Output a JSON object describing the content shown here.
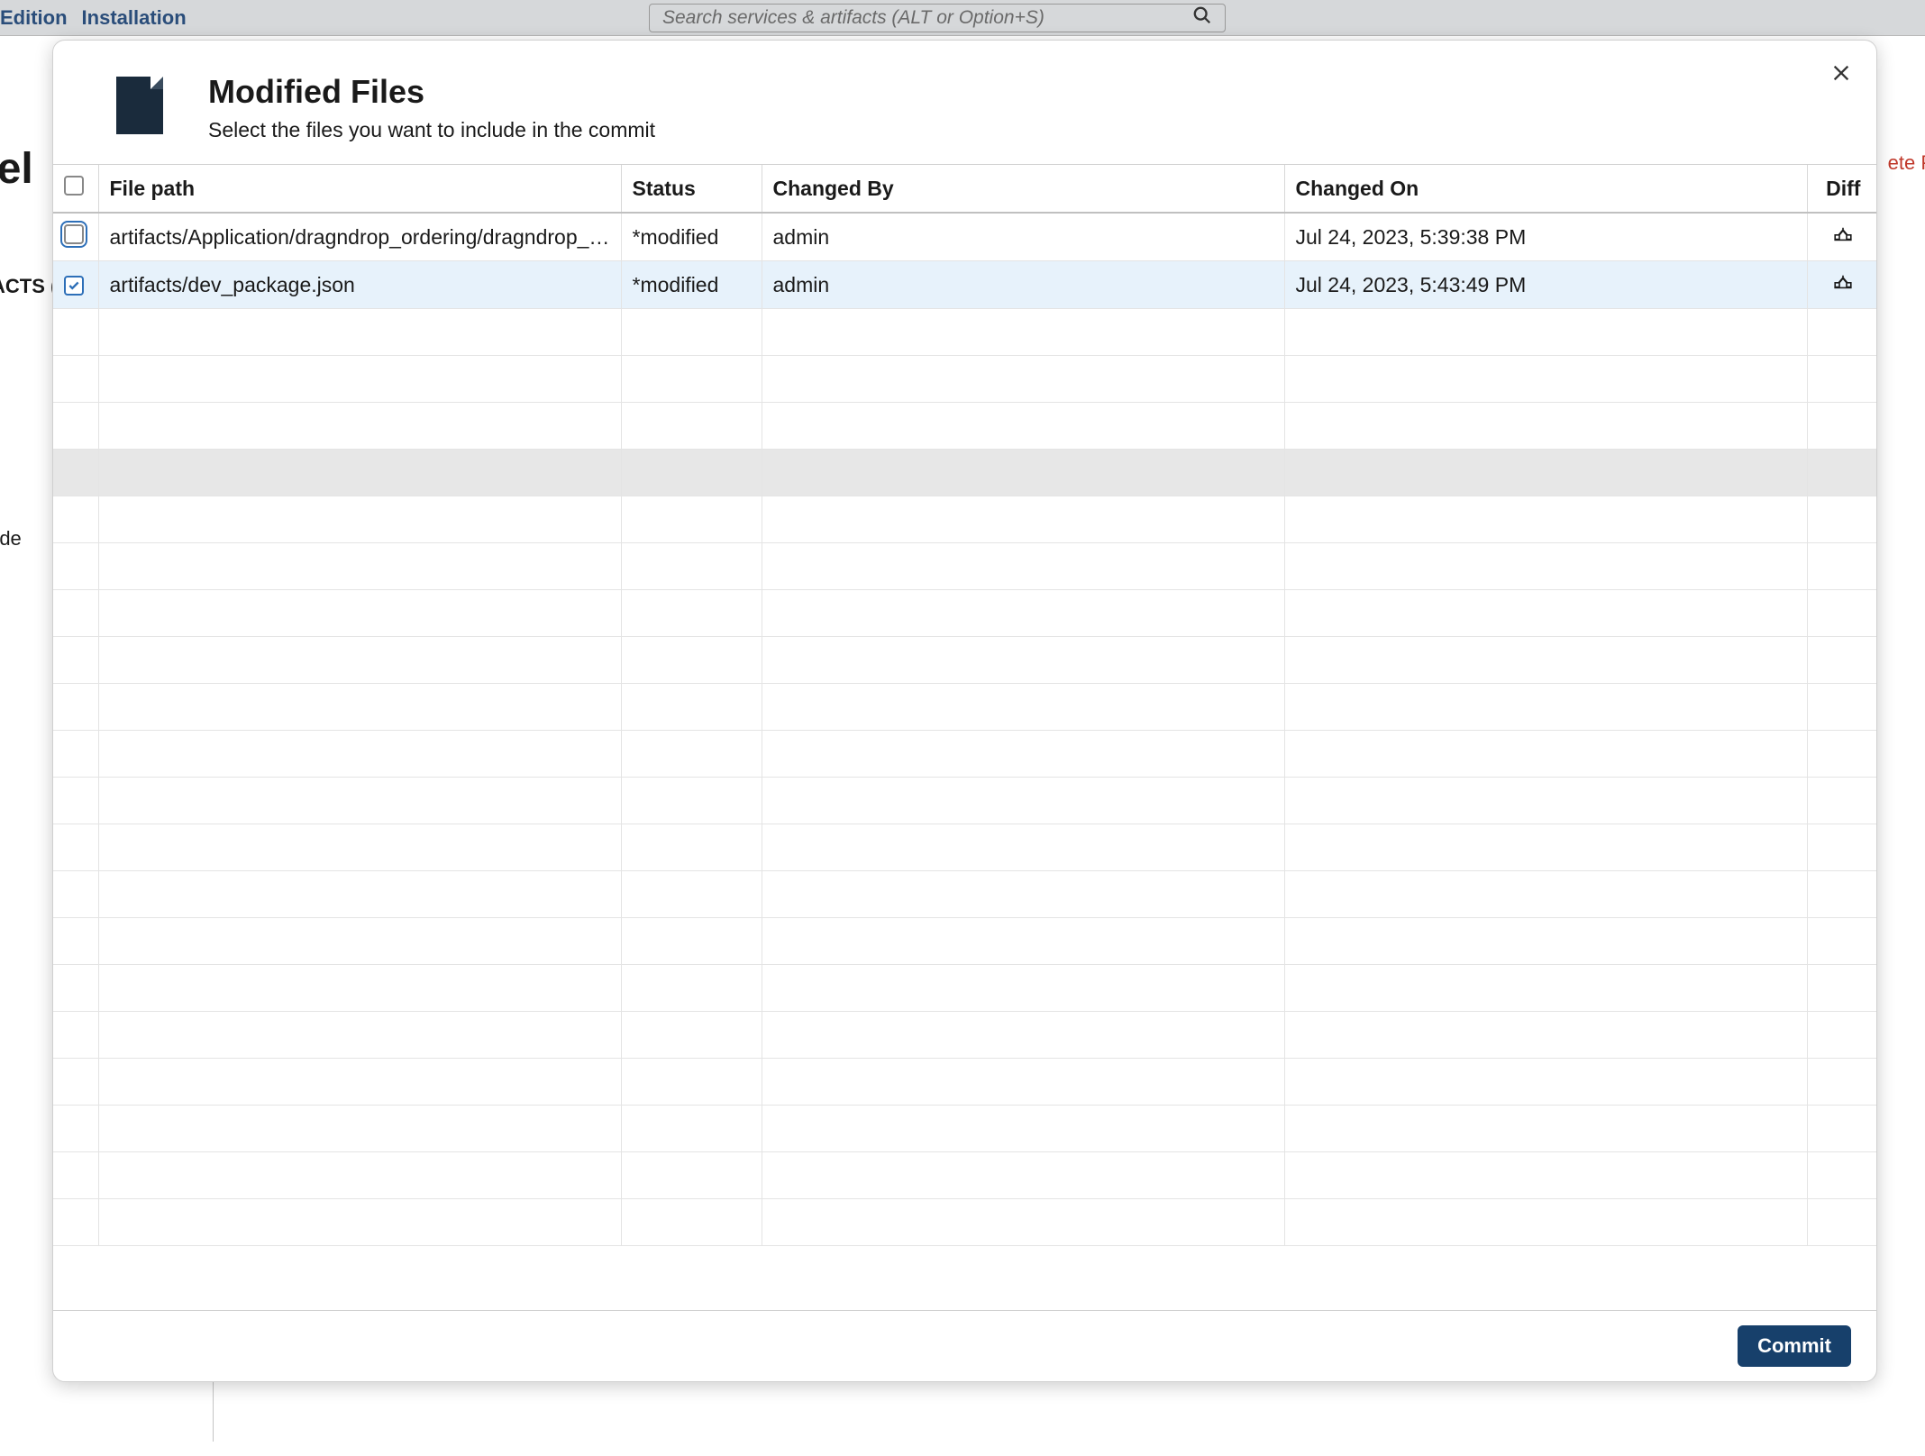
{
  "topbar": {
    "menu1": "Edition",
    "menu2": "Installation",
    "search_placeholder": "Search services & artifacts (ALT or Option+S)"
  },
  "background": {
    "title_fragment": "vel",
    "side_fragment": "ACTS (",
    "side_fragment2": "/ci-de",
    "right_btn_fragment": "ete P"
  },
  "modal": {
    "title": "Modified Files",
    "subtitle": "Select the files you want to include in the commit",
    "commit_button": "Commit"
  },
  "table": {
    "headers": {
      "file_path": "File path",
      "status": "Status",
      "changed_by": "Changed By",
      "changed_on": "Changed On",
      "diff": "Diff"
    },
    "rows": [
      {
        "checked": false,
        "focused": true,
        "file_path": "artifacts/Application/dragndrop_ordering/dragndrop_or...",
        "status": "*modified",
        "changed_by": "admin",
        "changed_on": "Jul 24, 2023, 5:39:38 PM"
      },
      {
        "checked": true,
        "focused": false,
        "file_path": "artifacts/dev_package.json",
        "status": "*modified",
        "changed_by": "admin",
        "changed_on": "Jul 24, 2023, 5:43:49 PM"
      }
    ]
  }
}
